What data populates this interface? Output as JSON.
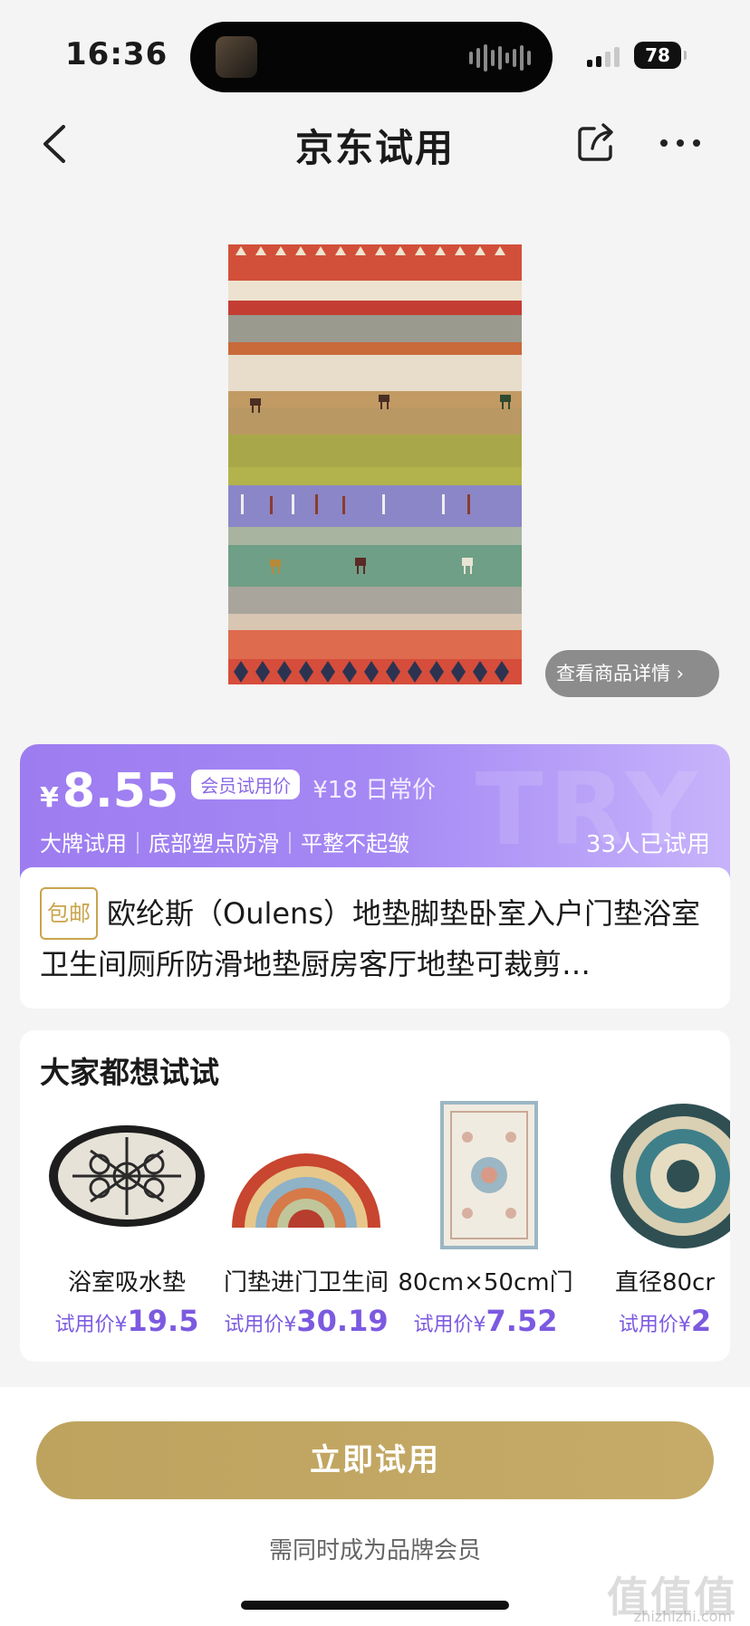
{
  "status_bar": {
    "time": "16:36",
    "battery": "78"
  },
  "nav": {
    "title": "京东试用"
  },
  "product": {
    "detail_link": "查看商品详情 ›"
  },
  "price_card": {
    "currency": "¥",
    "price": "8.55",
    "member_badge": "会员试用价",
    "daily_price": "¥18 日常价",
    "features": "大牌试用｜底部塑点防滑｜平整不起皱",
    "tried_count": "33人已试用",
    "watermark": "TRY"
  },
  "title_card": {
    "shipping_tag": "包邮",
    "title": "欧纶斯（Oulens）地垫脚垫卧室入户门垫浴室卫生间厕所防滑地垫厨房客厅地垫可裁剪…"
  },
  "recommend": {
    "heading": "大家都想试试",
    "items": [
      {
        "name": "浴室吸水垫",
        "price_label": "试用价¥",
        "price": "19.5"
      },
      {
        "name": "门垫进门卫生间",
        "price_label": "试用价¥",
        "price": "30.19"
      },
      {
        "name": "80cm×50cm门",
        "price_label": "试用价¥",
        "price": "7.52"
      },
      {
        "name": "直径80cr",
        "price_label": "试用价¥",
        "price": "2"
      }
    ]
  },
  "bottom": {
    "cta": "立即试用",
    "note": "需同时成为品牌会员",
    "site_mark": "值值值",
    "site_sub": "zhizhizhi.com"
  },
  "colors": {
    "accent_purple": "#9d7cf0",
    "gold": "#bda35e",
    "price_purple": "#7c5ae0"
  }
}
